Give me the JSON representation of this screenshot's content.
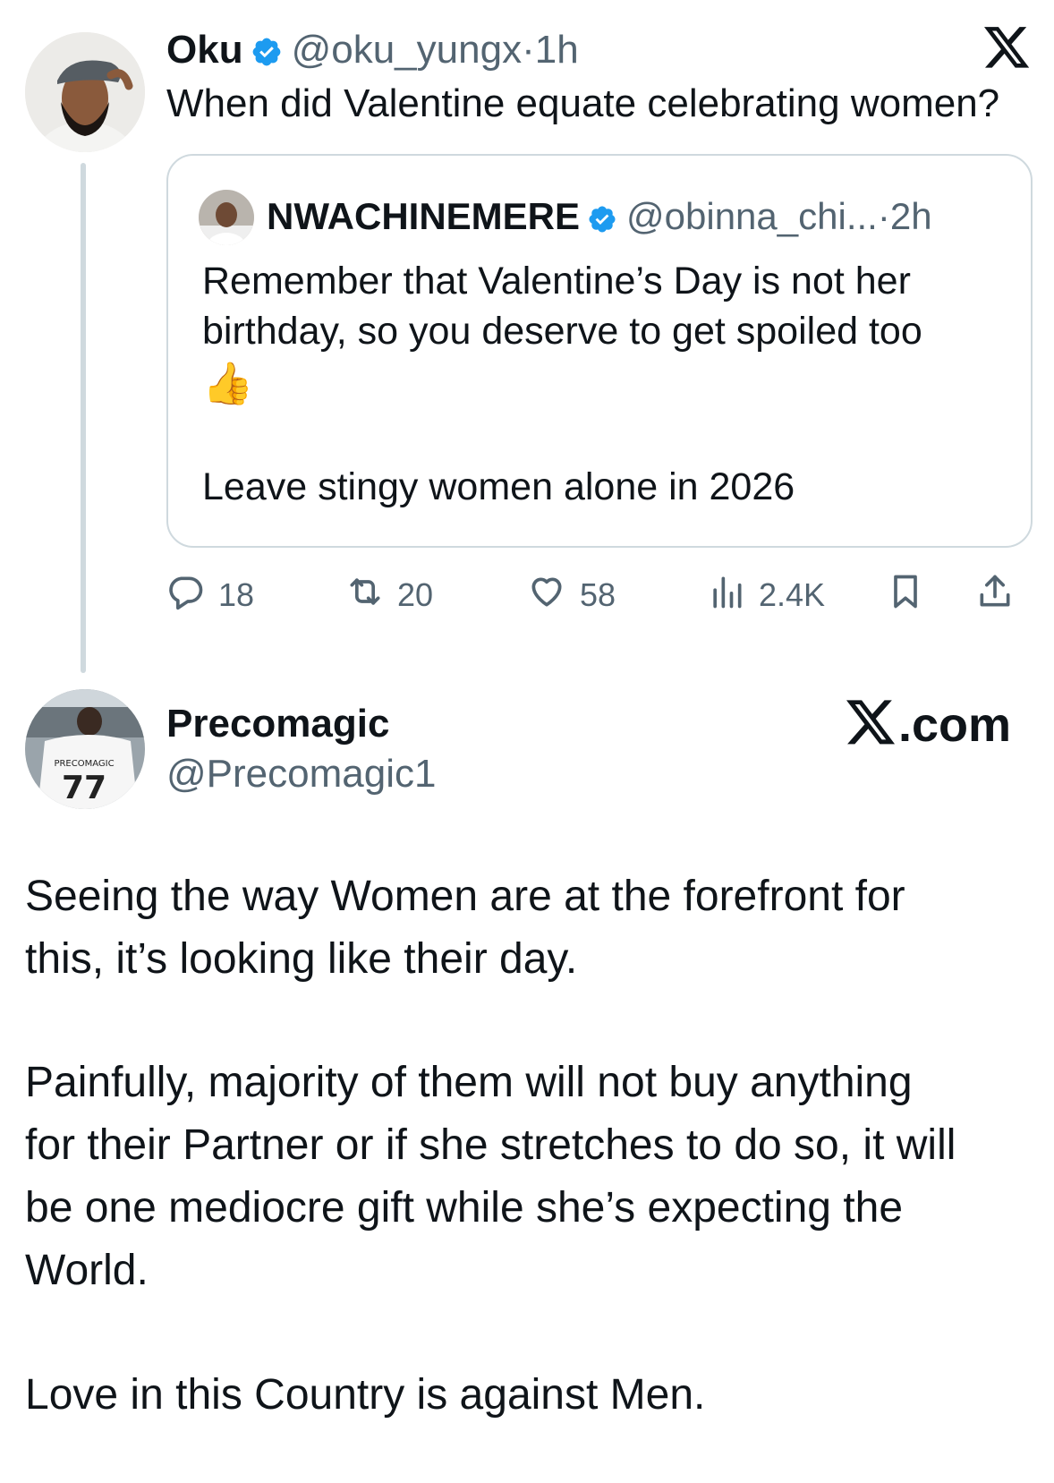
{
  "brand_colors": {
    "verified": "#1d9bf0",
    "secondary_text": "#536471",
    "divider": "#cfd9de"
  },
  "main_tweet": {
    "author": {
      "name": "Oku",
      "handle": "@oku_yungx",
      "time": "1h",
      "verified": true,
      "avatar": "avatar-oku"
    },
    "text": "When did Valentine equate celebrating women?",
    "quoted_tweet": {
      "author": {
        "name": "NWACHINEMERE",
        "handle": "@obinna_chi...",
        "time": "2h",
        "verified": true,
        "avatar": "avatar-nwachinemere"
      },
      "lines": [
        "Remember that Valentine’s Day is not her",
        "birthday, so you deserve to get spoiled too",
        "👍",
        "Leave stingy women alone in 2026"
      ]
    },
    "actions": {
      "replies": "18",
      "reposts": "20",
      "likes": "58",
      "views": "2.4K",
      "icons": [
        "reply-icon",
        "repost-icon",
        "like-icon",
        "views-icon",
        "bookmark-icon",
        "share-icon"
      ]
    }
  },
  "separator": "·",
  "second_tweet": {
    "author": {
      "name": "Precomagic",
      "handle": "@Precomagic1",
      "avatar": "avatar-precomagic",
      "jersey_text": "PRECOMAGIC",
      "jersey_number": "77"
    },
    "watermark": {
      "dotcom": ".com"
    },
    "paragraphs": [
      [
        "Seeing the way Women are at the forefront for",
        "this, it’s looking like their day."
      ],
      [
        "Painfully, majority of them will not buy anything",
        "for their Partner or if she stretches to do so, it will",
        "be one mediocre gift while she’s expecting the",
        "World."
      ],
      [
        "Love in this Country is against Men."
      ]
    ]
  }
}
